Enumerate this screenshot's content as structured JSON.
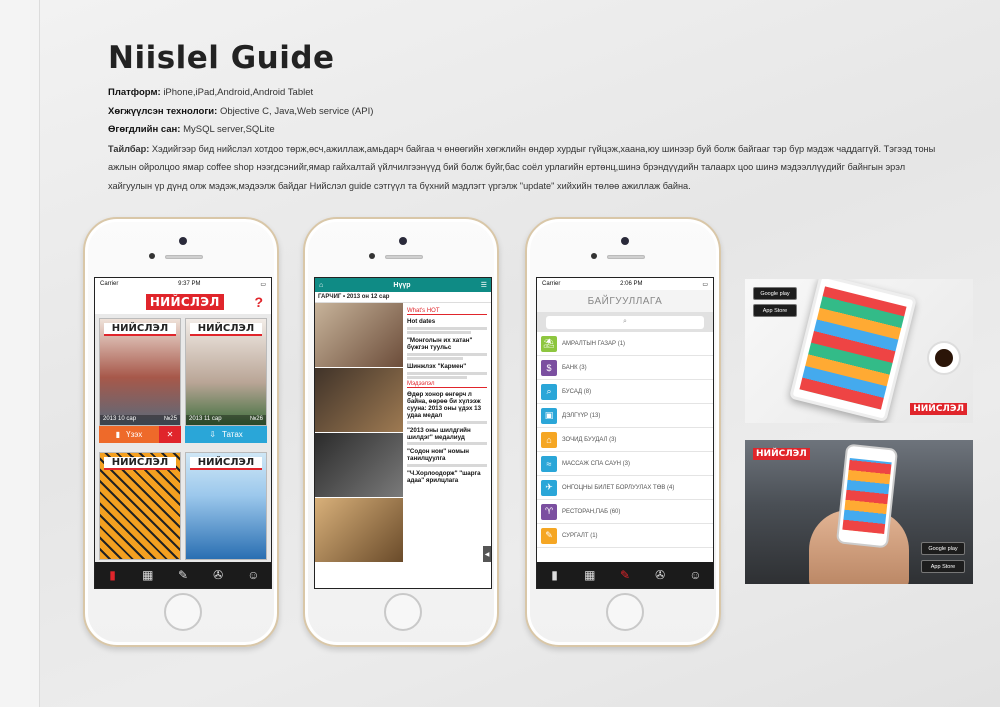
{
  "page": {
    "title": "Niislel Guide",
    "platform_label": "Платформ:",
    "platform_value": "iPhone,iPad,Android,Android Tablet",
    "tech_label": "Хөгжүүлсэн технологи:",
    "tech_value": "Objective C, Java,Web service (API)",
    "db_label": "Өгөгдлийн сан:",
    "db_value": "MySQL server,SQLite",
    "desc_label": "Тайлбар:",
    "desc_value": "Хэдийгээр бид нийслэл хотдоо төрж,өсч,ажиллаж,амьдарч байгаа ч өнөөгийн хөгжлийн өндөр хурдыг гүйцэж,хаана,юу шинээр буй болж байгааг тэр бүр мэдэж чаддаггүй. Тэгээд тоны ажлын ойролцоо ямар coffee shop нээгдсэнийг,ямар гайхалтай үйлчилгээнүүд бий болж буйг,бас соёл урлагийн ертөнц,шинэ брэндүүдийн талаарх цоо шинэ мэдээллүүдийг байнгын эрэл хайгуулын үр дүнд олж мэдэж,мэдээлж байдаг Нийслэл guide сэтгүүл та бүхний мэдлэгт үргэлж \"update\" хийхийн төлөө ажиллаж байна."
  },
  "phone1": {
    "carrier": "Carrier",
    "time": "9:37 PM",
    "logo": "НИЙСЛЭЛ",
    "help": "?",
    "covers": [
      {
        "logo": "НИЙСЛЭЛ",
        "date": "2013 10 сар",
        "issue": "№25"
      },
      {
        "logo": "НИЙСЛЭЛ",
        "date": "2013 11 сар",
        "issue": "№26"
      },
      {
        "logo": "НИЙСЛЭЛ",
        "date": "",
        "issue": ""
      },
      {
        "logo": "НИЙСЛЭЛ",
        "date": "",
        "issue": ""
      }
    ],
    "read_label": "Үзэх",
    "close_label": "✕",
    "download_label": "Татах"
  },
  "phone2": {
    "header_title": "Нүүр",
    "subheader": "ГАРЧИГ • 2013 он 12 сар",
    "section1": "What's HOT",
    "items": [
      {
        "title": "Hot dates"
      },
      {
        "title": "\"Монголын их хатан\" бүжгэн туульс"
      },
      {
        "title": "Шинжлэх \"Кармен\""
      },
      {
        "title": "Өдөр хонор өнгөрч л байна, өөрөө би хүлээж суунa: 2013 оны үдэх 13 удаа медал"
      },
      {
        "title": "\"2013 оны шилдгийн шилдэг\" медалиуд"
      },
      {
        "title": "\"Содон ном\" номын танилцуулга"
      },
      {
        "title": "\"Ч.Хорлоодорж\" \"шарга адаа\" ярилцлага"
      }
    ],
    "section2": "Мэдээлэл"
  },
  "phone3": {
    "carrier": "Carrier",
    "time": "2:06 PM",
    "title": "БАЙГУУЛЛАГА",
    "search_icon": "⌕",
    "categories": [
      {
        "label": "АМРАЛТЫН ГАЗАР (1)",
        "color": "#8dc63f",
        "icon": "⛱"
      },
      {
        "label": "БАНК (3)",
        "color": "#7b4fa0",
        "icon": "$"
      },
      {
        "label": "БУСАД (8)",
        "color": "#2aa6d8",
        "icon": "⌕"
      },
      {
        "label": "ДЭЛГҮҮР (13)",
        "color": "#2aa6d8",
        "icon": "▣"
      },
      {
        "label": "ЗОЧИД БУУДАЛ (3)",
        "color": "#f5a623",
        "icon": "⌂"
      },
      {
        "label": "МАССАЖ СПА САУН (3)",
        "color": "#2aa6d8",
        "icon": "≈"
      },
      {
        "label": "ОНГОЦНЫ БИЛЕТ БОРЛУУЛАХ ТӨВ (4)",
        "color": "#2aa6d8",
        "icon": "✈"
      },
      {
        "label": "РЕСТОРАН,ПАБ (60)",
        "color": "#7b4fa0",
        "icon": "♈"
      },
      {
        "label": "СУРГАЛТ (1)",
        "color": "#f5a623",
        "icon": "✎"
      }
    ]
  },
  "promo": {
    "google_play": "Google play",
    "app_store": "App Store",
    "logo": "НИЙСЛЭЛ"
  }
}
